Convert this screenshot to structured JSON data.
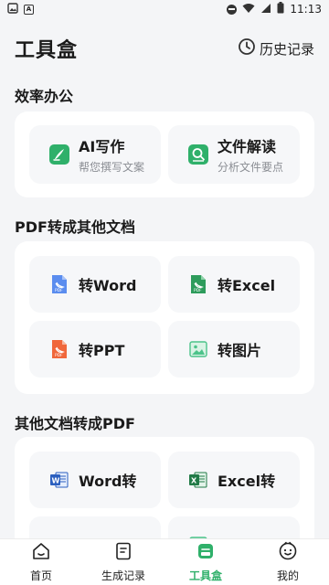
{
  "status_bar": {
    "time": "11:13",
    "app_badge": "A"
  },
  "header": {
    "title": "工具盒",
    "history_label": "历史记录"
  },
  "sections": [
    {
      "title": "效率办公",
      "tiles": [
        {
          "label": "AI写作",
          "subtitle": "帮您撰写文案",
          "icon": "pen-icon"
        },
        {
          "label": "文件解读",
          "subtitle": "分析文件要点",
          "icon": "document-search-icon"
        }
      ]
    },
    {
      "title": "PDF转成其他文档",
      "tiles": [
        {
          "label": "转Word",
          "icon": "pdf-file-icon"
        },
        {
          "label": "转Excel",
          "icon": "excel-file-icon"
        },
        {
          "label": "转PPT",
          "icon": "pdf-red-file-icon"
        },
        {
          "label": "转图片",
          "icon": "image-icon"
        }
      ]
    },
    {
      "title": "其他文档转成PDF",
      "tiles": [
        {
          "label": "Word转",
          "icon": "word-icon"
        },
        {
          "label": "Excel转",
          "icon": "excel-icon"
        }
      ]
    }
  ],
  "bottom_nav": [
    {
      "label": "首页",
      "icon": "home-icon"
    },
    {
      "label": "生成记录",
      "icon": "record-icon"
    },
    {
      "label": "工具盒",
      "icon": "toolbox-icon",
      "active": true
    },
    {
      "label": "我的",
      "icon": "profile-icon"
    }
  ],
  "colors": {
    "accent": "#2fb06a",
    "background": "#f4f5f7",
    "card": "#ffffff",
    "tile": "#f6f7f9"
  }
}
